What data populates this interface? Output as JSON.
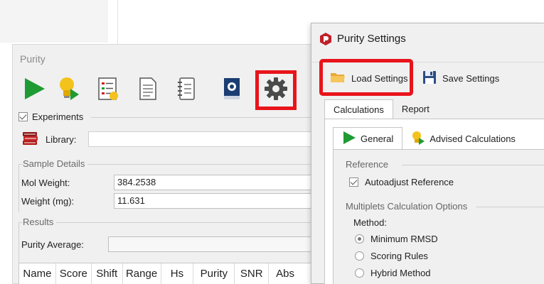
{
  "purity_window": {
    "title": "Purity",
    "toolbar": [
      {
        "icon": "play-icon"
      },
      {
        "icon": "advise-bulb-icon"
      },
      {
        "icon": "checklist-icon"
      },
      {
        "icon": "document-icon"
      },
      {
        "icon": "notebook-icon"
      },
      {
        "icon": "book-icon"
      },
      {
        "icon": "settings-gear-icon"
      }
    ],
    "experiments_label": "Experiments",
    "experiments_checked": true,
    "library_label": "Library:",
    "library_value": "",
    "sample_details": {
      "title": "Sample Details",
      "mol_weight_label": "Mol Weight:",
      "mol_weight_value": "384.2538",
      "weight_label": "Weight (mg):",
      "weight_value": "11.631"
    },
    "results": {
      "title": "Results",
      "purity_average_label": "Purity Average:",
      "purity_average_value": "",
      "columns": [
        "Name",
        "Score",
        "Shift",
        "Range",
        "Hs",
        "Purity",
        "SNR",
        "Abs"
      ]
    }
  },
  "dialog": {
    "title": "Purity Settings",
    "load_settings_label": "Load Settings",
    "save_settings_label": "Save Settings",
    "tabs": [
      "Calculations",
      "Report"
    ],
    "active_tab": "Calculations",
    "subtabs": [
      "General",
      "Advised Calculations"
    ],
    "active_subtab": "General",
    "reference_section": "Reference",
    "autoadjust_label": "Autoadjust Reference",
    "autoadjust_checked": true,
    "multiplets_section": "Multiplets Calculation Options",
    "method_label": "Method:",
    "methods": [
      "Minimum RMSD",
      "Scoring Rules",
      "Hybrid Method"
    ],
    "selected_method": "Minimum RMSD"
  },
  "colors": {
    "highlight": "#e8141b",
    "play_green": "#1e9b33",
    "bulb_yellow": "#f4c21c"
  }
}
